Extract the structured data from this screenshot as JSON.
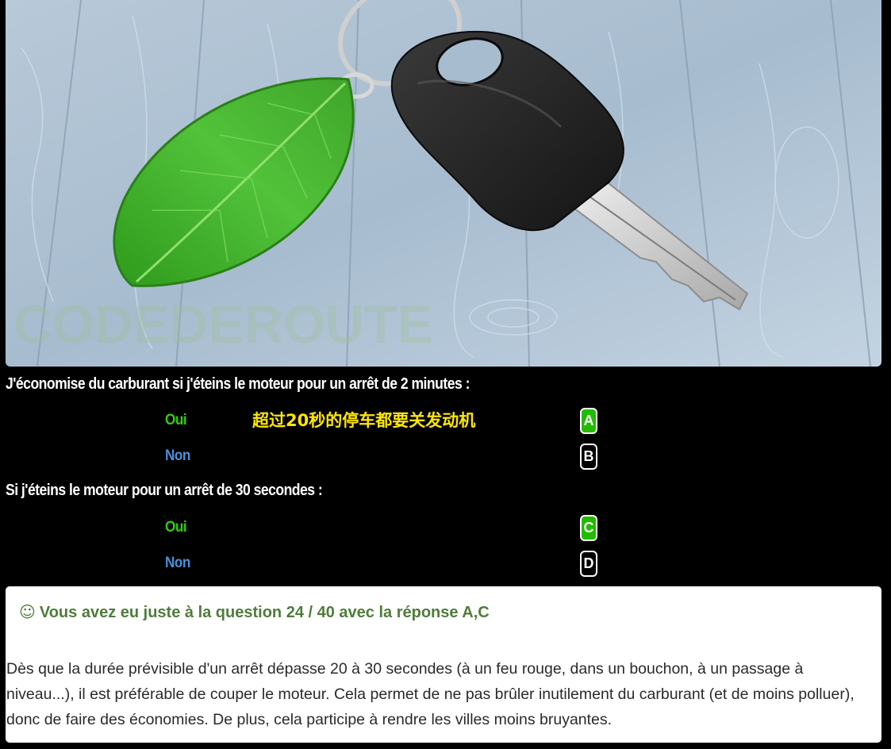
{
  "illustration": {
    "description_icon": "car-key-with-leaf",
    "watermark": "CODEDEROUTE"
  },
  "questions": [
    {
      "text": "J'économise du carburant si j'éteins le moteur pour un arrêt de 2 minutes :",
      "options": [
        {
          "label": "Oui",
          "letter": "A",
          "correct": true
        },
        {
          "label": "Non",
          "letter": "B",
          "correct": false
        }
      ]
    },
    {
      "text": "Si j'éteins le moteur pour un arrêt de 30 secondes :",
      "options": [
        {
          "label": "Oui",
          "letter": "C",
          "correct": true
        },
        {
          "label": "Non",
          "letter": "D",
          "correct": false
        }
      ]
    }
  ],
  "note": "超过20秒的停车都要关发动机",
  "result": {
    "icon": "smiley-icon",
    "icon_glyph": "☺",
    "heading": "Vous avez eu juste à la question 24 / 40 avec la réponse A,C",
    "explanation": "Dès que la durée prévisible d'un arrêt dépasse 20 à 30 secondes (à un feu rouge, dans un bouchon, à un passage à niveau...), il est préférable de couper le moteur. Cela permet de ne pas brûler inutilement du carburant (et de moins polluer), donc de faire des économies. De plus, cela participe à rendre les villes moins bruyantes."
  },
  "colors": {
    "background": "#000000",
    "yes": "#33cc11",
    "no": "#4a90d9",
    "correct_letter": "#22bb00",
    "note": "#ffe600",
    "result_heading": "#4e7d3a"
  }
}
